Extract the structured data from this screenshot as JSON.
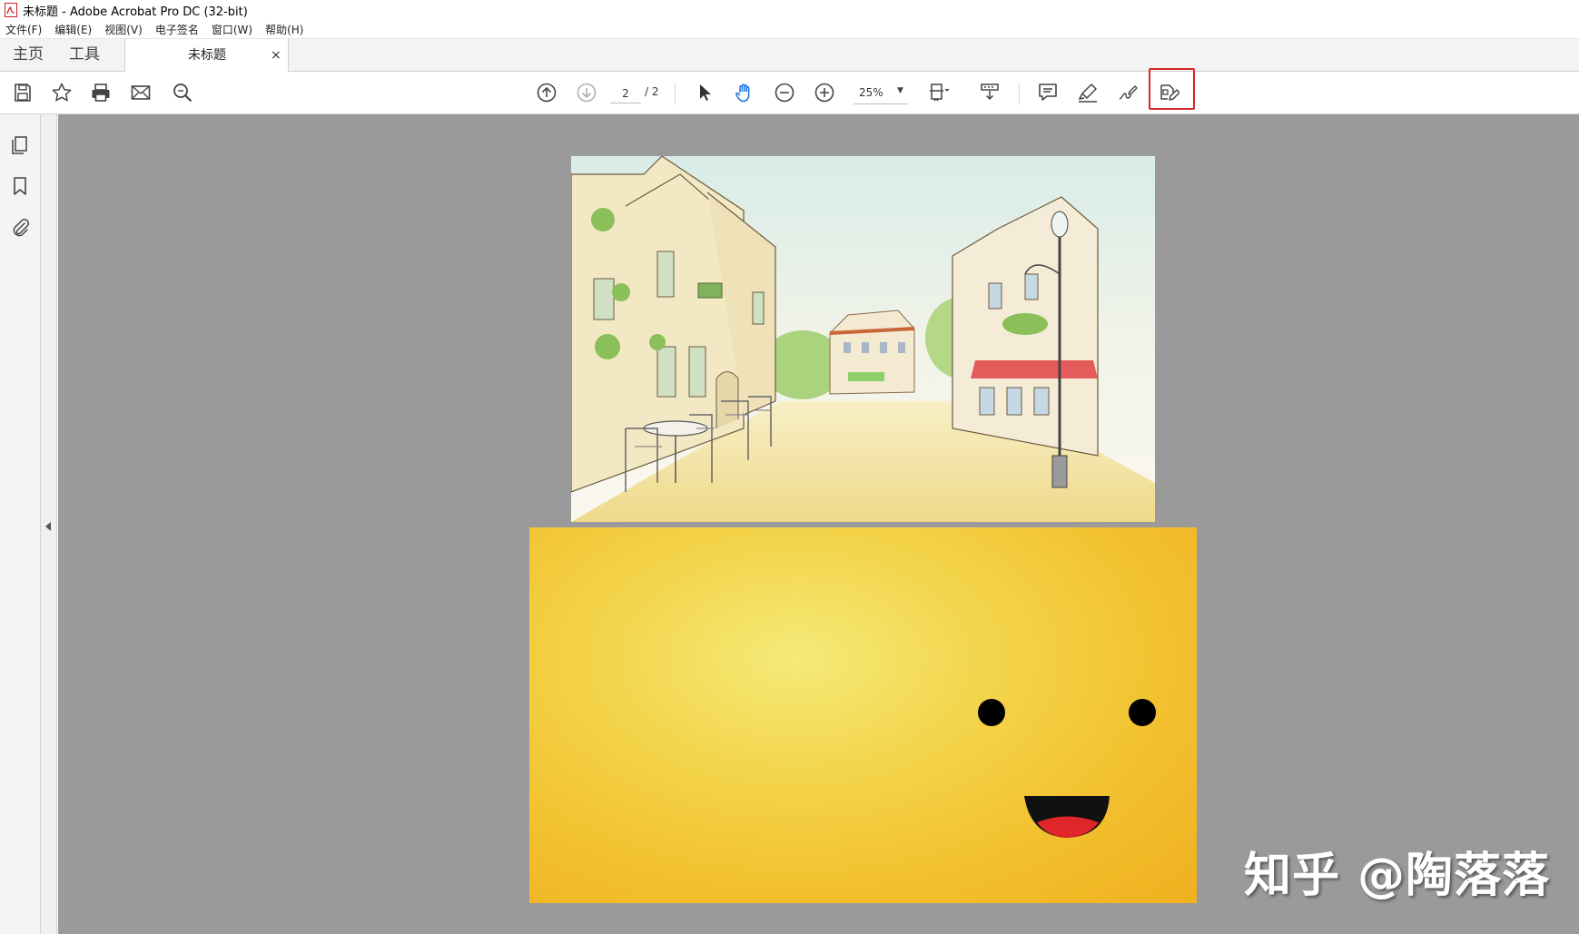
{
  "window": {
    "title": "未标题 - Adobe Acrobat Pro DC (32-bit)"
  },
  "menu": [
    {
      "label": "文件(F)"
    },
    {
      "label": "编辑(E)"
    },
    {
      "label": "视图(V)"
    },
    {
      "label": "电子签名"
    },
    {
      "label": "窗口(W)"
    },
    {
      "label": "帮助(H)"
    }
  ],
  "tabs": {
    "home": "主页",
    "tools": "工具",
    "document": "未标题",
    "close": "×"
  },
  "toolbar": {
    "page_current": "2",
    "page_total": "/ 2",
    "zoom": "25%",
    "zoom_caret": "▼"
  },
  "colors": {
    "canvas": "#9a9a9a",
    "highlight": "#d6282b",
    "accent_blue": "#1473e6"
  },
  "watermark": "知乎 @陶落落"
}
